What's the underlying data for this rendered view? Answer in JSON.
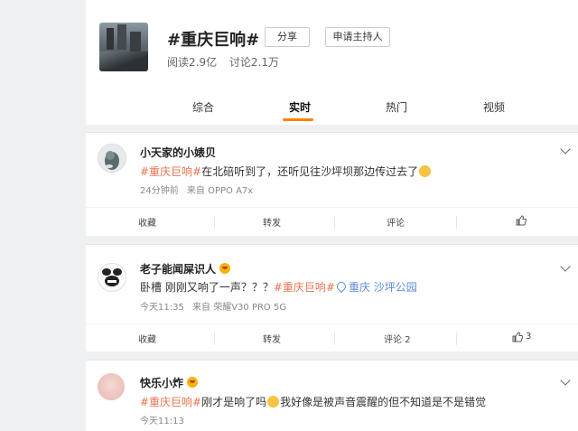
{
  "topic": {
    "title": "#重庆巨响#",
    "share_label": "分享",
    "host_label": "申请主持人",
    "reads": "阅读2.9亿",
    "discussions": "讨论2.1万"
  },
  "tabs": [
    {
      "label": "综合"
    },
    {
      "label": "实时"
    },
    {
      "label": "热门"
    },
    {
      "label": "视频"
    }
  ],
  "posts": [
    {
      "username": "小天家的小婊贝",
      "text_tag": "#重庆巨响#",
      "text_body": "在北碚听到了，还听见往沙坪坝那边传过去了",
      "time": "24分钟前",
      "source": "来自 OPPO A7x",
      "actions": {
        "collect": "收藏",
        "repost": "转发",
        "comment": "评论",
        "like": ""
      }
    },
    {
      "username": "老子能闻屎识人",
      "text_prefix": "卧槽 刚刚又响了一声？？？",
      "text_tag": "#重庆巨响#",
      "location": "重庆",
      "location_detail": "沙坪公园",
      "time": "今天11:35",
      "source": "来自 荣耀V30 PRO 5G",
      "actions": {
        "collect": "收藏",
        "repost": "转发",
        "comment": "评论 2",
        "like": "3"
      }
    },
    {
      "username": "快乐小炸",
      "text_tag": "#重庆巨响#",
      "text_body_1": "刚才是响了吗",
      "text_body_2": "我好像是被声音震醒的但不知道是不是错觉",
      "time": "今天11:13"
    }
  ],
  "colors": {
    "accent": "#ff8200",
    "tag": "#eb7350",
    "link": "#5b8bd9"
  }
}
